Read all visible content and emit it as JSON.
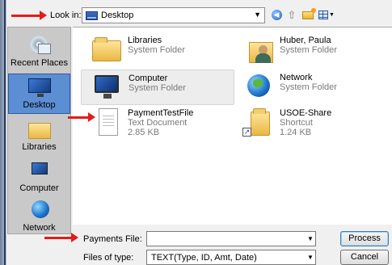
{
  "lookin": {
    "label": "Look in:",
    "value": "Desktop"
  },
  "places": [
    {
      "label": "Recent Places",
      "icon": "recent-places-icon"
    },
    {
      "label": "Desktop",
      "icon": "desktop-icon",
      "selected": true
    },
    {
      "label": "Libraries",
      "icon": "libraries-icon"
    },
    {
      "label": "Computer",
      "icon": "computer-icon"
    },
    {
      "label": "Network",
      "icon": "network-icon"
    }
  ],
  "items": [
    {
      "name": "Libraries",
      "sub1": "System Folder",
      "sub2": "",
      "icon": "libraries-folder-icon"
    },
    {
      "name": "Huber, Paula",
      "sub1": "System Folder",
      "sub2": "",
      "icon": "user-folder-icon"
    },
    {
      "name": "Computer",
      "sub1": "System Folder",
      "sub2": "",
      "icon": "computer-icon",
      "selected": true
    },
    {
      "name": "Network",
      "sub1": "System Folder",
      "sub2": "",
      "icon": "network-globe-icon"
    },
    {
      "name": "PaymentTestFile",
      "sub1": "Text Document",
      "sub2": "2.85 KB",
      "icon": "text-document-icon"
    },
    {
      "name": "USOE-Share",
      "sub1": "Shortcut",
      "sub2": "1.24 KB",
      "icon": "shortcut-folder-icon"
    }
  ],
  "bottom": {
    "file_label": "Payments File:",
    "file_value": "",
    "type_label": "Files of type:",
    "type_value": "TEXT(Type, ID, Amt, Date)",
    "process_label": "Process",
    "cancel_label": "Cancel"
  },
  "colors": {
    "annotation_arrow": "#e31b1b",
    "selection": "#5c8ed3"
  }
}
